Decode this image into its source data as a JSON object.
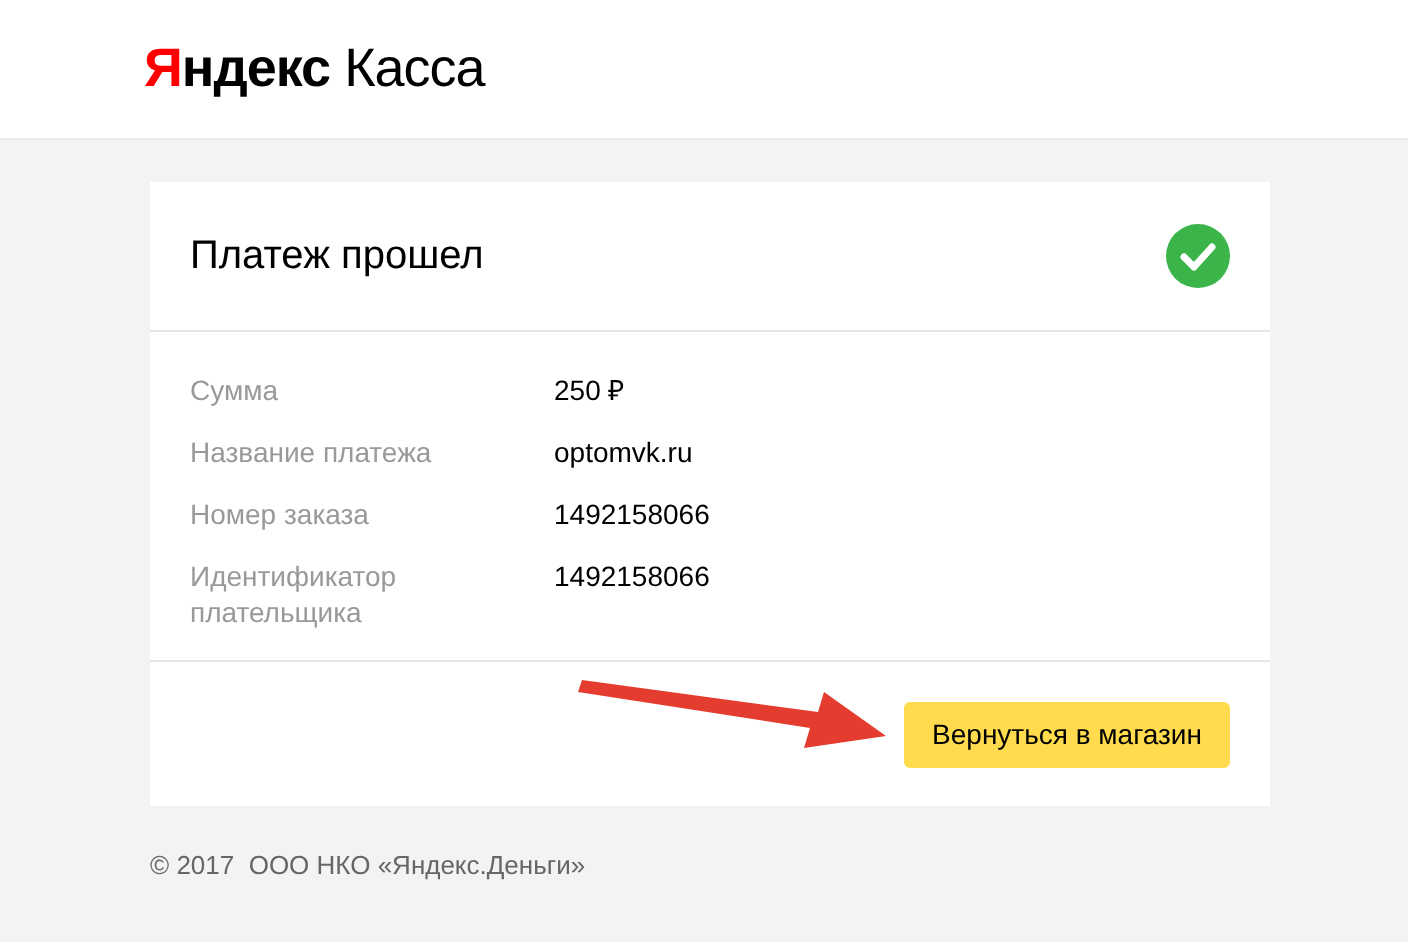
{
  "header": {
    "logo": {
      "first_letter": "Я",
      "brand_rest": "ндекс",
      "product": "Касса"
    }
  },
  "card": {
    "title": "Платеж прошел",
    "kind": "success",
    "details": [
      {
        "label": "Сумма",
        "value": "250 ₽"
      },
      {
        "label": "Название платежа",
        "value": "optomvk.ru"
      },
      {
        "label": "Номер заказа",
        "value": "1492158066"
      },
      {
        "label": "Идентификатор плательщика",
        "value": "1492158066"
      }
    ],
    "button": "Вернуться в магазин"
  },
  "footer": "© 2017  ООО НКО «Яндекс.Деньги»"
}
